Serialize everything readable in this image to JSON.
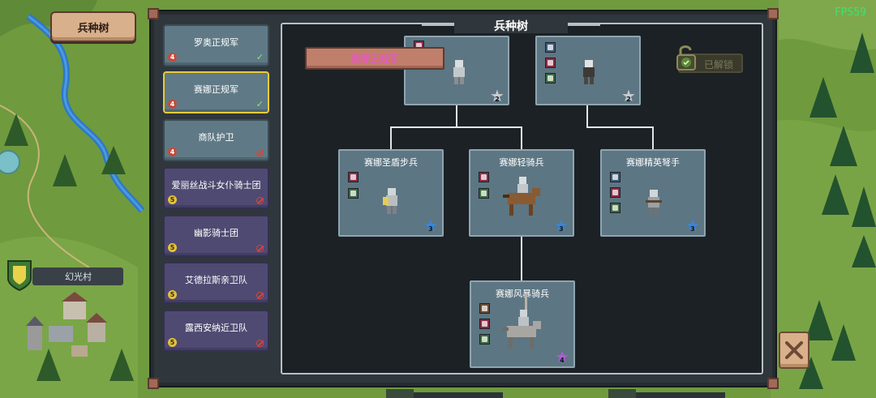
{
  "hud": {
    "tab_button": "兵种树",
    "fps": "FPS59",
    "village_name": "幻光村"
  },
  "unit_list": [
    {
      "name": "罗奥正规军",
      "tier": "4",
      "status": "unlocked"
    },
    {
      "name": "赛娜正规军",
      "tier": "4",
      "status": "unlocked",
      "selected": true
    },
    {
      "name": "商队护卫",
      "tier": "4",
      "status": "locked"
    },
    {
      "name": "爱丽丝战斗女仆骑士团",
      "tier": "5",
      "status": "locked"
    },
    {
      "name": "幽影骑士团",
      "tier": "5",
      "status": "locked"
    },
    {
      "name": "艾德拉斯亲卫队",
      "tier": "5",
      "status": "locked"
    },
    {
      "name": "露西安纳近卫队",
      "tier": "5",
      "status": "locked"
    }
  ],
  "tree": {
    "title": "兵种树",
    "selected_banner": "赛娜正规军",
    "unlocked_label": "已解锁",
    "nodes": {
      "top_left": {
        "star": "2"
      },
      "top_right": {
        "star": "2"
      },
      "shield_infantry": {
        "name": "赛娜圣盾步兵",
        "star": "3"
      },
      "light_cavalry": {
        "name": "赛娜轻骑兵",
        "star": "3"
      },
      "crossbow": {
        "name": "赛娜精英弩手",
        "star": "3"
      },
      "wind_cavalry": {
        "name": "赛娜风暴骑兵",
        "star": "4"
      }
    }
  },
  "colors": {
    "star_silver": "#c8ccd0",
    "star_blue": "#3a86d8",
    "star_purple": "#b05ad8"
  }
}
